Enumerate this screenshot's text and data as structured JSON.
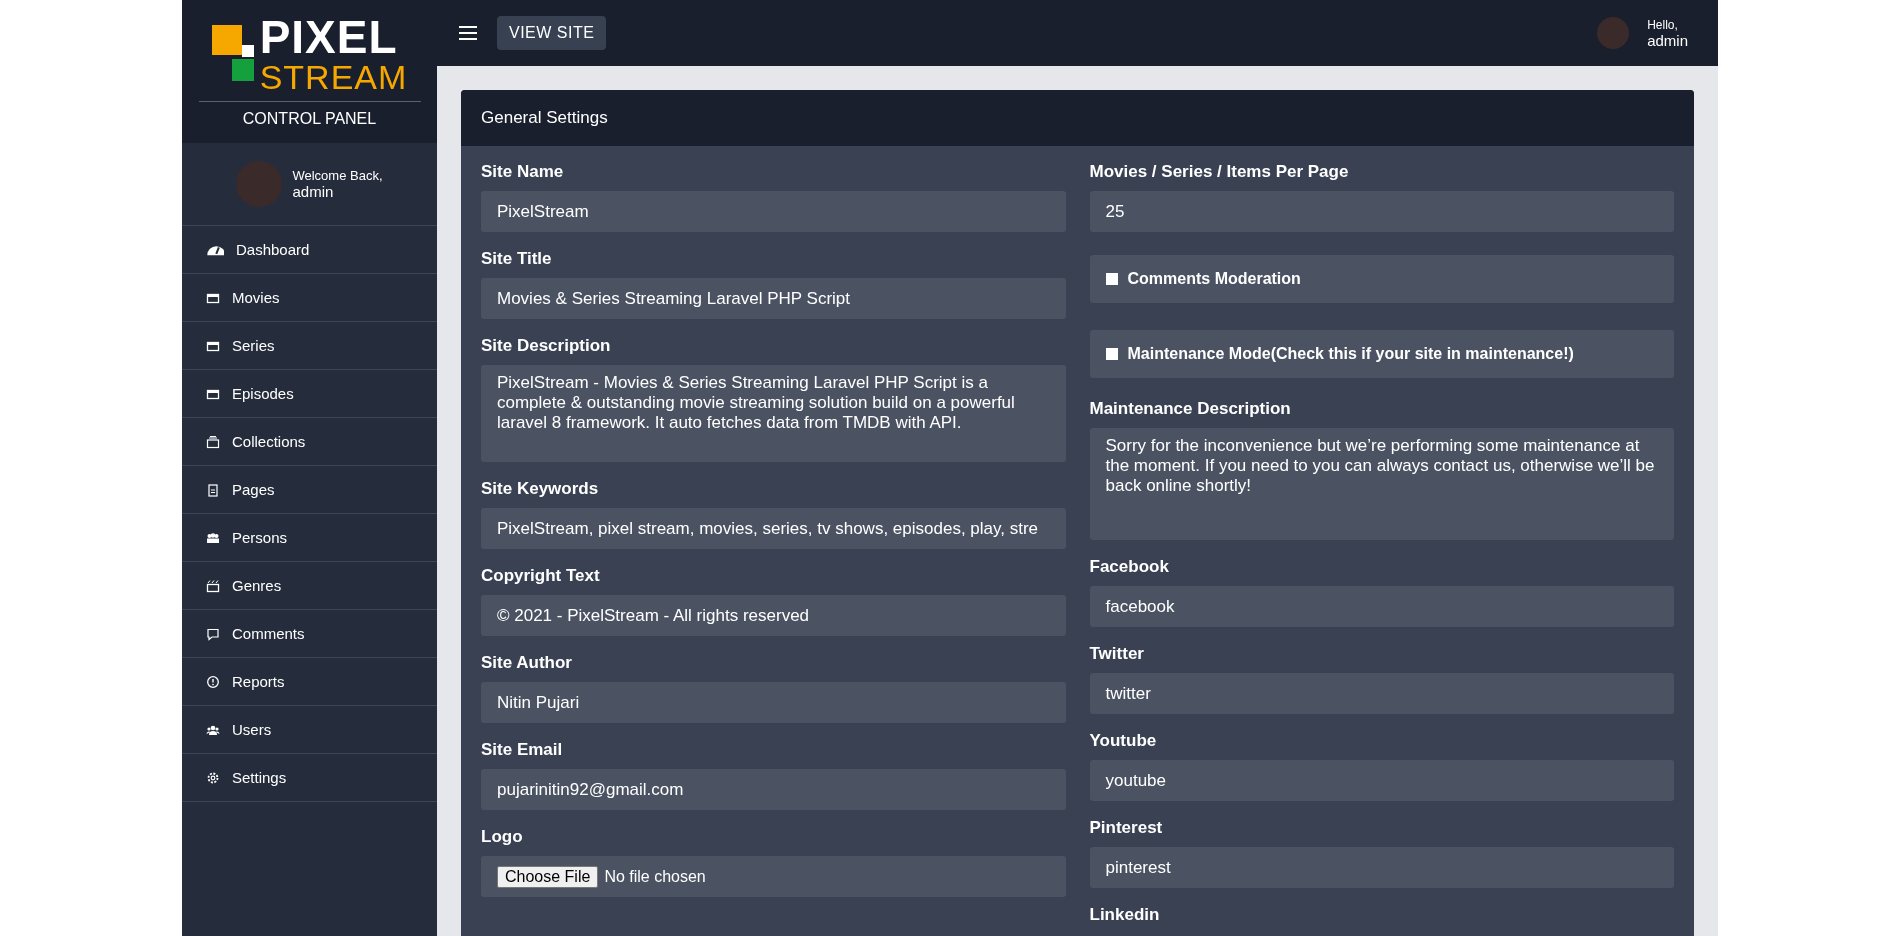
{
  "sidebar": {
    "logo": {
      "line_1": "PIXEL",
      "line_2": "STREAM"
    },
    "subtitle": "CONTROL PANEL",
    "user": {
      "greeting": "Welcome Back,",
      "name": "admin"
    },
    "items": [
      {
        "label": "Dashboard"
      },
      {
        "label": "Movies"
      },
      {
        "label": "Series"
      },
      {
        "label": "Episodes"
      },
      {
        "label": "Collections"
      },
      {
        "label": "Pages"
      },
      {
        "label": "Persons"
      },
      {
        "label": "Genres"
      },
      {
        "label": "Comments"
      },
      {
        "label": "Reports"
      },
      {
        "label": "Users"
      },
      {
        "label": "Settings"
      }
    ]
  },
  "topbar": {
    "view_site": "VIEW SITE",
    "user": {
      "greeting": "Hello,",
      "name": "admin"
    }
  },
  "card": {
    "title": "General Settings",
    "left": [
      {
        "kind": "input",
        "label": "Site Name",
        "value": "PixelStream"
      },
      {
        "kind": "input",
        "label": "Site Title",
        "value": "Movies & Series Streaming Laravel PHP Script"
      },
      {
        "kind": "textarea",
        "label": "Site Description",
        "value": "PixelStream - Movies & Series Streaming Laravel PHP Script is a complete & outstanding movie streaming solution build on a powerful laravel 8 framework. It auto fetches data from TMDB with API."
      },
      {
        "kind": "input",
        "label": "Site Keywords",
        "value": "PixelStream, pixel stream, movies, series, tv shows, episodes, play, stre"
      },
      {
        "kind": "input",
        "label": "Copyright Text",
        "value": "© 2021 - PixelStream - All rights reserved"
      },
      {
        "kind": "input",
        "label": "Site Author",
        "value": "Nitin Pujari"
      },
      {
        "kind": "input",
        "label": "Site Email",
        "value": "pujarinitin92@gmail.com"
      },
      {
        "kind": "file",
        "label": "Logo",
        "button": "Choose File",
        "value": "No file chosen"
      }
    ],
    "right": [
      {
        "kind": "input",
        "label": "Movies / Series / Items Per Page",
        "value": "25"
      },
      {
        "kind": "checkbox",
        "label": "Comments Moderation",
        "checked": false
      },
      {
        "kind": "checkbox",
        "label": "Maintenance Mode(Check this if your site in maintenance!)",
        "checked": false
      },
      {
        "kind": "textarea",
        "label": "Maintenance Description",
        "value": "Sorry for the inconvenience but we’re performing some maintenance at the moment. If you need to you can always contact us, otherwise we’ll be back online shortly!"
      },
      {
        "kind": "input",
        "label": "Facebook",
        "value": "facebook"
      },
      {
        "kind": "input",
        "label": "Twitter",
        "value": "twitter"
      },
      {
        "kind": "input",
        "label": "Youtube",
        "value": "youtube"
      },
      {
        "kind": "input",
        "label": "Pinterest",
        "value": "pinterest"
      },
      {
        "kind": "label",
        "label": "Linkedin"
      }
    ]
  }
}
